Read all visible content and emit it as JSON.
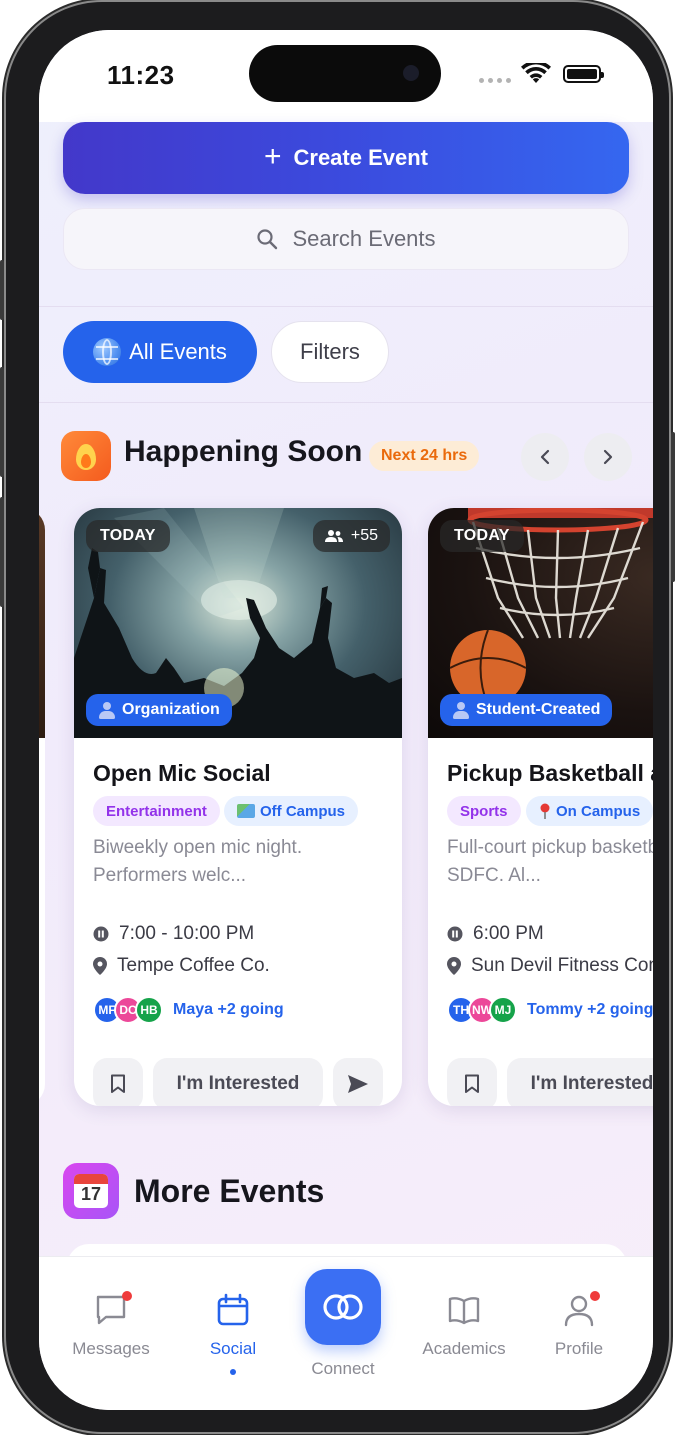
{
  "status_bar": {
    "time": "11:23"
  },
  "create_event_label": "Create Event",
  "search": {
    "placeholder": "Search Events"
  },
  "filter_chips": {
    "all_events": "All Events",
    "filters": "Filters"
  },
  "happening_soon": {
    "title": "Happening Soon",
    "badge": "Next 24 hrs",
    "cards": [
      {
        "day": "TODAY",
        "attendee_count": "+55",
        "creator_type": "Organization",
        "title": "Open Mic Social",
        "category": "Entertainment",
        "location_type": "Off Campus",
        "description": "Biweekly open mic night. Performers welc...",
        "time": "7:00 - 10:00 PM",
        "venue": "Tempe Coffee Co.",
        "avatars": [
          "MF",
          "DC",
          "HB"
        ],
        "going": "Maya +2 going",
        "interested_label": "I'm Interested"
      },
      {
        "day": "TODAY",
        "creator_type": "Student-Created",
        "title": "Pickup Basketball at SDFC",
        "category": "Sports",
        "location_type": "On Campus",
        "description": "Full-court pickup basketball at SDFC. Al...",
        "time": "6:00 PM",
        "venue": "Sun Devil Fitness Complex",
        "avatars": [
          "TH",
          "NW",
          "MJ"
        ],
        "going": "Tommy +2 going",
        "interested_label": "I'm Interested"
      }
    ]
  },
  "more_events": {
    "title": "More Events",
    "calendar_day": "17"
  },
  "tab_bar": {
    "items": [
      {
        "label": "Messages"
      },
      {
        "label": "Social"
      },
      {
        "label": "Connect"
      },
      {
        "label": "Academics"
      },
      {
        "label": "Profile"
      }
    ],
    "active": "Social"
  },
  "colors": {
    "primary": "#2563eb",
    "create_gradient_start": "#4338ca",
    "badge_orange": "#ea6a0c",
    "entertainment": "#9333ea",
    "notification": "#ef3b3b"
  }
}
